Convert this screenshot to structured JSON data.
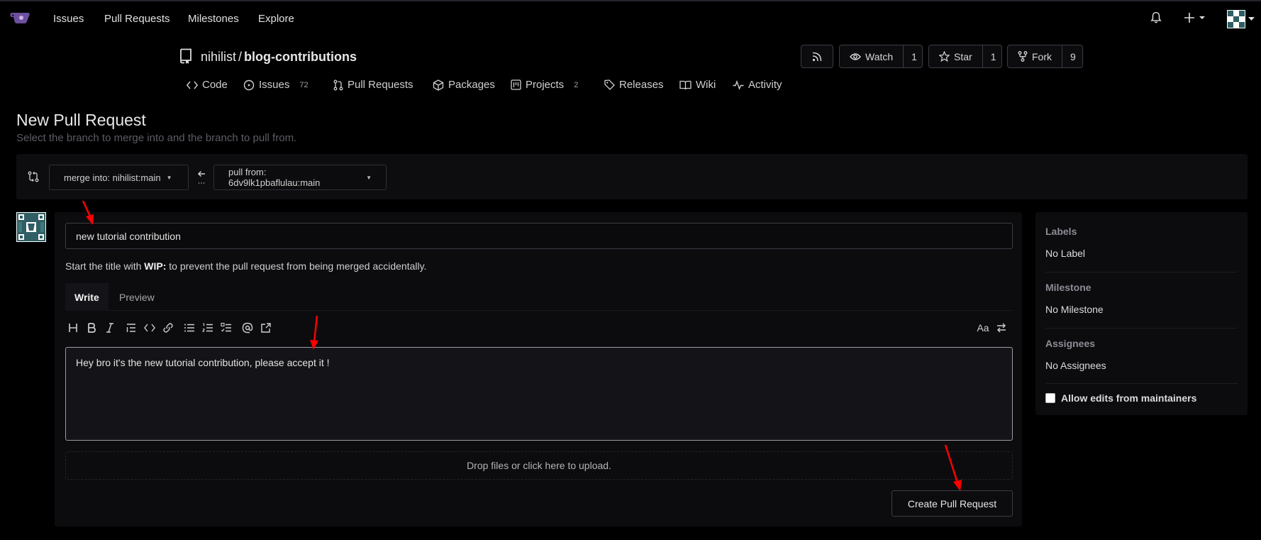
{
  "nav": {
    "items": [
      {
        "label": "Issues"
      },
      {
        "label": "Pull Requests"
      },
      {
        "label": "Milestones"
      },
      {
        "label": "Explore"
      }
    ],
    "icons": [
      "bell-icon",
      "plus-icon",
      "avatar"
    ]
  },
  "repo": {
    "owner": "nihilist",
    "separator": "/",
    "name": "blog-contributions",
    "watch": {
      "label": "Watch",
      "count": "1"
    },
    "star": {
      "label": "Star",
      "count": "1"
    },
    "fork": {
      "label": "Fork",
      "count": "9"
    },
    "tabs": [
      {
        "label": "Code",
        "badge": ""
      },
      {
        "label": "Issues",
        "badge": "72"
      },
      {
        "label": "Pull Requests",
        "badge": ""
      },
      {
        "label": "Packages",
        "badge": ""
      },
      {
        "label": "Projects",
        "badge": "2"
      },
      {
        "label": "Releases",
        "badge": ""
      },
      {
        "label": "Wiki",
        "badge": ""
      },
      {
        "label": "Activity",
        "badge": ""
      }
    ]
  },
  "page": {
    "title": "New Pull Request",
    "subtitle": "Select the branch to merge into and the branch to pull from."
  },
  "branches": {
    "merge_into": "merge into: nihilist:main",
    "pull_from": "pull from: 6dv9lk1pbaflulau:main"
  },
  "form": {
    "title_value": "new tutorial contribution",
    "wip_prefix": "Start the title with",
    "wip_keyword": "WIP:",
    "wip_suffix": "to prevent the pull request from being merged accidentally.",
    "tab_write": "Write",
    "tab_preview": "Preview",
    "body_value": "Hey bro it's the new tutorial contribution, please accept it !",
    "dropzone": "Drop files or click here to upload.",
    "submit_label": "Create Pull Request",
    "toolbar_right_label": "Aa"
  },
  "sidebar": {
    "labels_heading": "Labels",
    "labels_value": "No Label",
    "milestone_heading": "Milestone",
    "milestone_value": "No Milestone",
    "assignees_heading": "Assignees",
    "assignees_value": "No Assignees",
    "allow_edits": "Allow edits from maintainers"
  },
  "colors": {
    "background": "#000000",
    "panel": "#0c0c0f",
    "annotation": "#ff0000"
  }
}
